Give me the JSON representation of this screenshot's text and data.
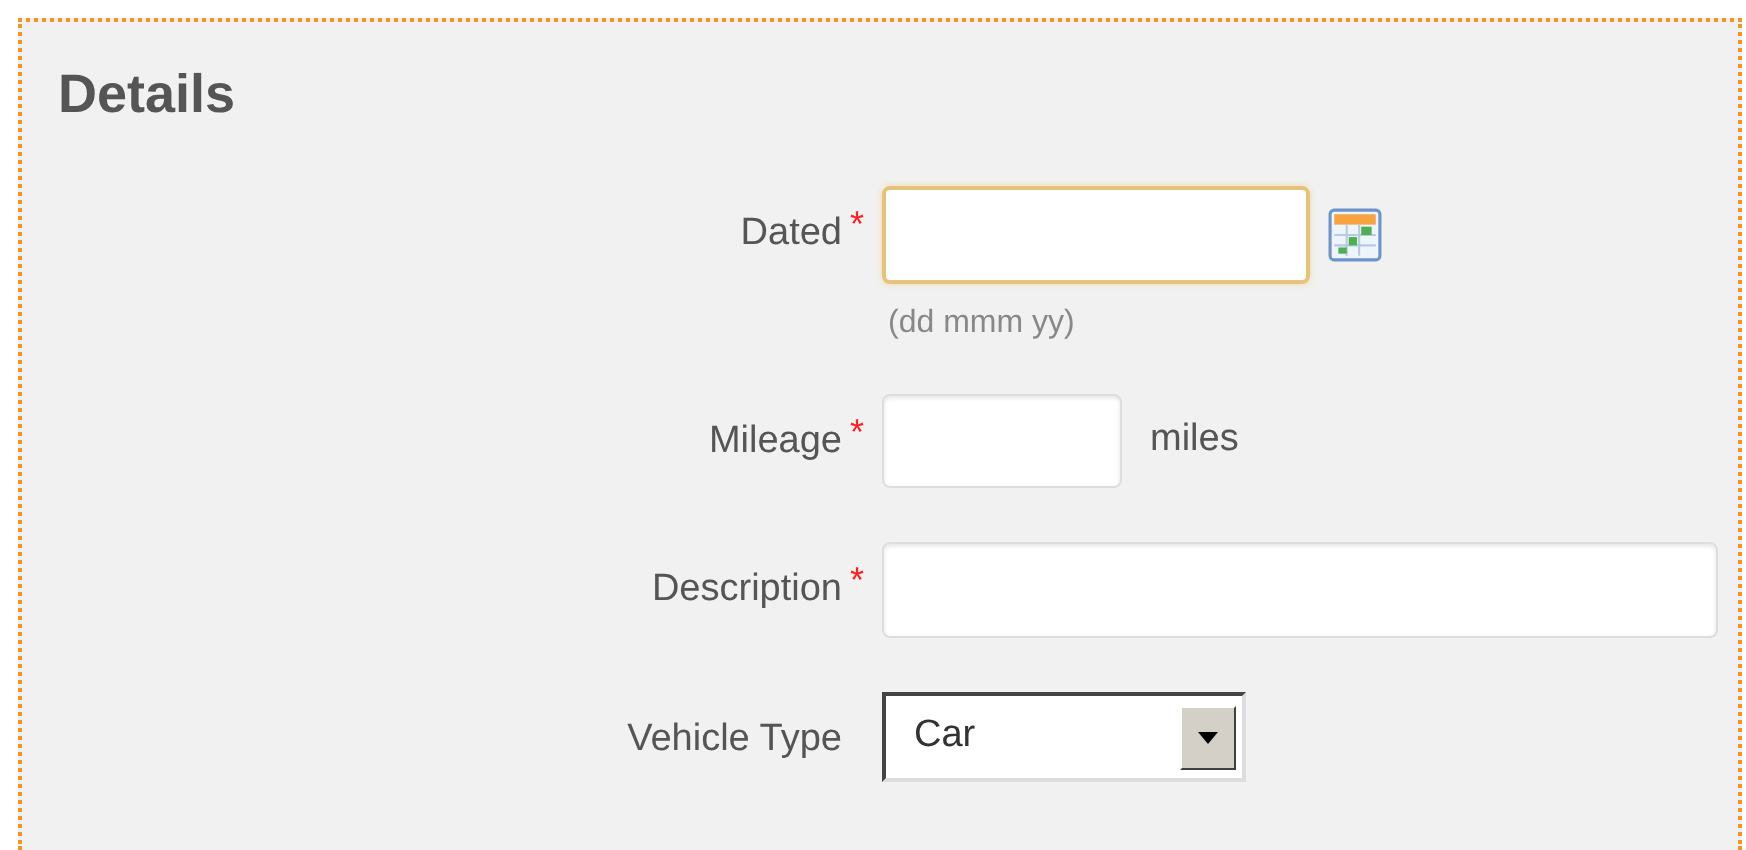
{
  "title": "Details",
  "fields": [
    {
      "kind": "date",
      "label": "Dated",
      "required_marker": "*",
      "focused": true,
      "hint": "(dd mmm yy)"
    },
    {
      "kind": "number",
      "label": "Mileage",
      "required_marker": "*",
      "focused": false,
      "unit": "miles"
    },
    {
      "kind": "text",
      "label": "Description",
      "required_marker": "*",
      "focused": false
    },
    {
      "kind": "select",
      "label": "Vehicle Type",
      "value": "Car"
    }
  ]
}
